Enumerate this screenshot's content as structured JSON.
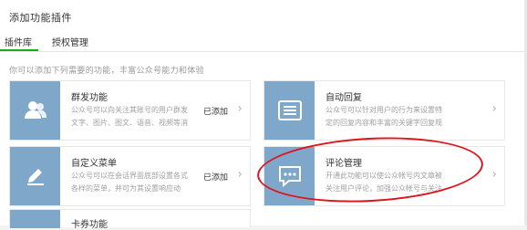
{
  "page": {
    "title": "添加功能插件",
    "tabs": [
      {
        "label": "插件库",
        "active": true
      },
      {
        "label": "授权管理",
        "active": false
      }
    ],
    "description": "你可以添加下列需要的功能，丰富公众号能力和体验"
  },
  "plugins": [
    {
      "name": "群发功能",
      "description": "公众号可以向关注其账号的用户群发文字、图片、图文、语音、视频等消息。",
      "status": "已添加",
      "icon": "users-icon"
    },
    {
      "name": "自动回复",
      "description": "公众号可以针对用户的行为来设置特定的回复内容和丰富的关键字回复规则。",
      "status": "",
      "icon": "message-list-icon"
    },
    {
      "name": "自定义菜单",
      "description": "公众号可以在会话界面底部设置各式各样的菜单，并可为其设置响应动作。",
      "status": "已添加",
      "icon": "pencil-icon"
    },
    {
      "name": "评论管理",
      "description": "开通此功能可以使公众帐号内文章被关注用户评论，加强公众帐号与关注用户之间的互",
      "status": "",
      "icon": "speech-bubble-icon"
    },
    {
      "name": "卡券功能",
      "description": "",
      "status": "",
      "icon": "card-icon"
    }
  ],
  "colors": {
    "icon_bg": "#7fa7c9",
    "accent": "#1aad19",
    "annotation": "#e0121b"
  }
}
